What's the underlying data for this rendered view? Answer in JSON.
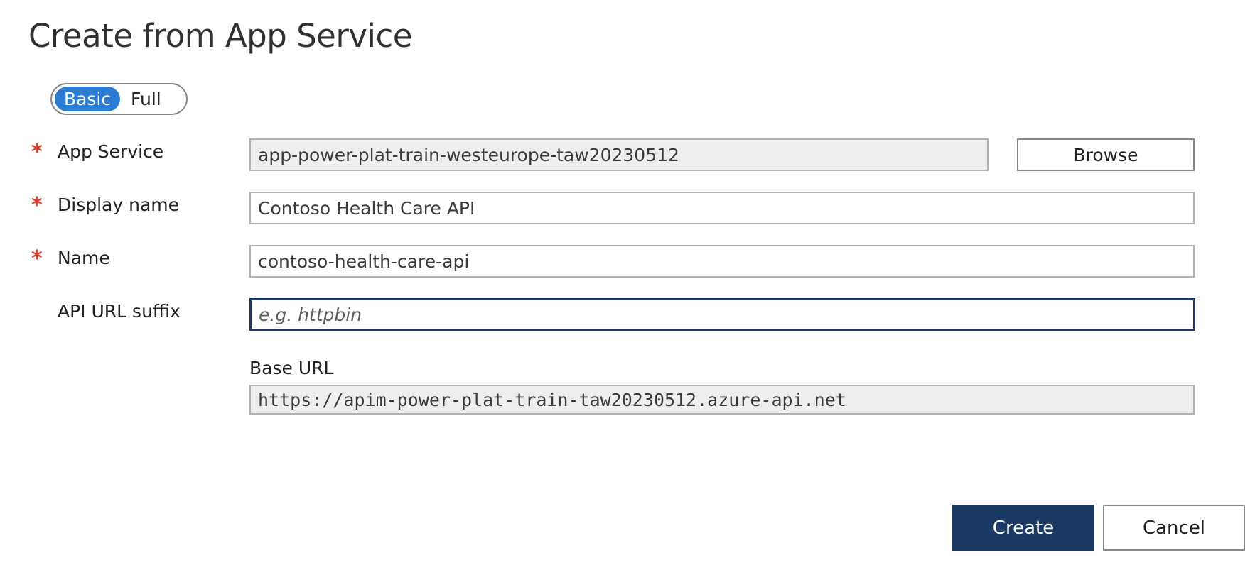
{
  "dialog": {
    "title": "Create from App Service"
  },
  "mode_toggle": {
    "options": [
      "Basic",
      "Full"
    ],
    "selected": "Basic"
  },
  "required_marker": "*",
  "fields": {
    "app_service": {
      "label": "App Service",
      "value": "app-power-plat-train-westeurope-taw20230512",
      "browse_label": "Browse"
    },
    "display_name": {
      "label": "Display name",
      "value": "Contoso Health Care API"
    },
    "name": {
      "label": "Name",
      "value": "contoso-health-care-api"
    },
    "api_url_suffix": {
      "label": "API URL suffix",
      "value": "",
      "placeholder": "e.g. httpbin"
    },
    "base_url": {
      "label": "Base URL",
      "value": "https://apim-power-plat-train-taw20230512.azure-api.net"
    }
  },
  "actions": {
    "create_label": "Create",
    "cancel_label": "Cancel"
  },
  "colors": {
    "toggle_active": "#2b7cd3",
    "primary_button": "#1b3a63",
    "required": "#e03e2d"
  }
}
